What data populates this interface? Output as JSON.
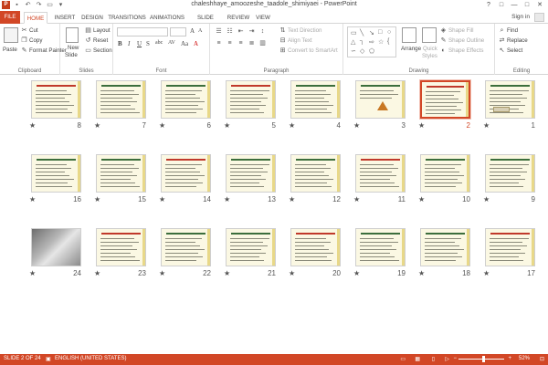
{
  "window": {
    "title": "chaleshhaye_amoozeshe_taadole_shimiyaei - PowerPoint",
    "app_icon": "P",
    "controls": [
      "?",
      "□",
      "—",
      "□",
      "✕"
    ]
  },
  "quick_access": [
    "save-icon",
    "undo-icon",
    "redo-icon",
    "present-icon",
    "customize-icon"
  ],
  "tabs": [
    {
      "label": "FILE"
    },
    {
      "label": "HOME"
    },
    {
      "label": "INSERT"
    },
    {
      "label": "DESIGN"
    },
    {
      "label": "TRANSITIONS"
    },
    {
      "label": "ANIMATIONS"
    },
    {
      "label": "SLIDE SHOW"
    },
    {
      "label": "REVIEW"
    },
    {
      "label": "VIEW"
    }
  ],
  "signin": "Sign in",
  "ribbon": {
    "clipboard": {
      "label": "Clipboard",
      "paste": "Paste",
      "cut": "Cut",
      "copy": "Copy",
      "format_painter": "Format Painter"
    },
    "slides": {
      "label": "Slides",
      "new_slide": "New",
      "new_slide_2": "Slide",
      "layout": "Layout",
      "reset": "Reset",
      "section": "Section"
    },
    "font": {
      "label": "Font",
      "bold": "B",
      "italic": "I",
      "underline": "U",
      "strike": "S",
      "shadow": "abc",
      "spacing": "AV",
      "case": "Aa",
      "color": "A"
    },
    "paragraph": {
      "label": "Paragraph",
      "text_direction": "Text Direction",
      "align_text": "Align Text",
      "smartart": "Convert to SmartArt"
    },
    "drawing": {
      "label": "Drawing",
      "arrange": "Arrange",
      "quick_styles": "Quick",
      "quick_styles_2": "Styles",
      "shape_fill": "Shape Fill",
      "shape_outline": "Shape Outline",
      "shape_effects": "Shape Effects"
    },
    "editing": {
      "label": "Editing",
      "find": "Find",
      "replace": "Replace",
      "select": "Select"
    }
  },
  "slides": [
    {
      "num": "1"
    },
    {
      "num": "2"
    },
    {
      "num": "3"
    },
    {
      "num": "4"
    },
    {
      "num": "5"
    },
    {
      "num": "6"
    },
    {
      "num": "7"
    },
    {
      "num": "8"
    },
    {
      "num": "9"
    },
    {
      "num": "10"
    },
    {
      "num": "11"
    },
    {
      "num": "12"
    },
    {
      "num": "13"
    },
    {
      "num": "14"
    },
    {
      "num": "15"
    },
    {
      "num": "16"
    },
    {
      "num": "17"
    },
    {
      "num": "18"
    },
    {
      "num": "19"
    },
    {
      "num": "20"
    },
    {
      "num": "21"
    },
    {
      "num": "22"
    },
    {
      "num": "23"
    },
    {
      "num": "24"
    }
  ],
  "selected_slide": "2",
  "star": "★",
  "status": {
    "slide_info": "SLIDE 2 OF 24",
    "language": "ENGLISH (UNITED STATES)",
    "zoom": "52%",
    "zoom_minus": "−",
    "zoom_plus": "+"
  },
  "colors": {
    "accent": "#d24726",
    "slide_bg": "#fbf8e3"
  }
}
